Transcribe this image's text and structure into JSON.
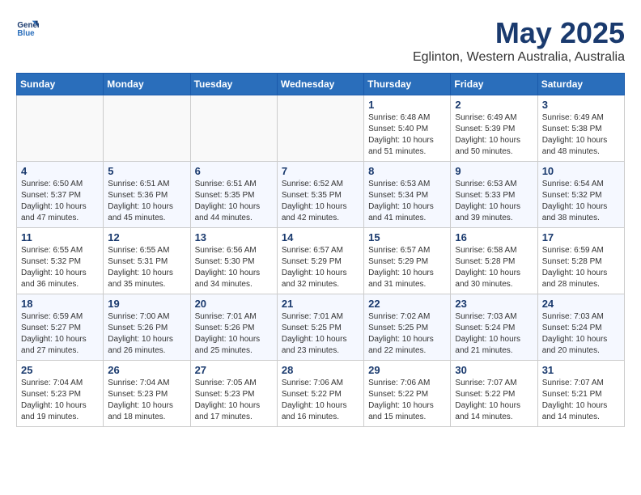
{
  "header": {
    "logo_line1": "General",
    "logo_line2": "Blue",
    "month": "May 2025",
    "location": "Eglinton, Western Australia, Australia"
  },
  "weekdays": [
    "Sunday",
    "Monday",
    "Tuesday",
    "Wednesday",
    "Thursday",
    "Friday",
    "Saturday"
  ],
  "weeks": [
    [
      {
        "day": "",
        "sunrise": "",
        "sunset": "",
        "daylight": ""
      },
      {
        "day": "",
        "sunrise": "",
        "sunset": "",
        "daylight": ""
      },
      {
        "day": "",
        "sunrise": "",
        "sunset": "",
        "daylight": ""
      },
      {
        "day": "",
        "sunrise": "",
        "sunset": "",
        "daylight": ""
      },
      {
        "day": "1",
        "sunrise": "Sunrise: 6:48 AM",
        "sunset": "Sunset: 5:40 PM",
        "daylight": "Daylight: 10 hours and 51 minutes."
      },
      {
        "day": "2",
        "sunrise": "Sunrise: 6:49 AM",
        "sunset": "Sunset: 5:39 PM",
        "daylight": "Daylight: 10 hours and 50 minutes."
      },
      {
        "day": "3",
        "sunrise": "Sunrise: 6:49 AM",
        "sunset": "Sunset: 5:38 PM",
        "daylight": "Daylight: 10 hours and 48 minutes."
      }
    ],
    [
      {
        "day": "4",
        "sunrise": "Sunrise: 6:50 AM",
        "sunset": "Sunset: 5:37 PM",
        "daylight": "Daylight: 10 hours and 47 minutes."
      },
      {
        "day": "5",
        "sunrise": "Sunrise: 6:51 AM",
        "sunset": "Sunset: 5:36 PM",
        "daylight": "Daylight: 10 hours and 45 minutes."
      },
      {
        "day": "6",
        "sunrise": "Sunrise: 6:51 AM",
        "sunset": "Sunset: 5:35 PM",
        "daylight": "Daylight: 10 hours and 44 minutes."
      },
      {
        "day": "7",
        "sunrise": "Sunrise: 6:52 AM",
        "sunset": "Sunset: 5:35 PM",
        "daylight": "Daylight: 10 hours and 42 minutes."
      },
      {
        "day": "8",
        "sunrise": "Sunrise: 6:53 AM",
        "sunset": "Sunset: 5:34 PM",
        "daylight": "Daylight: 10 hours and 41 minutes."
      },
      {
        "day": "9",
        "sunrise": "Sunrise: 6:53 AM",
        "sunset": "Sunset: 5:33 PM",
        "daylight": "Daylight: 10 hours and 39 minutes."
      },
      {
        "day": "10",
        "sunrise": "Sunrise: 6:54 AM",
        "sunset": "Sunset: 5:32 PM",
        "daylight": "Daylight: 10 hours and 38 minutes."
      }
    ],
    [
      {
        "day": "11",
        "sunrise": "Sunrise: 6:55 AM",
        "sunset": "Sunset: 5:32 PM",
        "daylight": "Daylight: 10 hours and 36 minutes."
      },
      {
        "day": "12",
        "sunrise": "Sunrise: 6:55 AM",
        "sunset": "Sunset: 5:31 PM",
        "daylight": "Daylight: 10 hours and 35 minutes."
      },
      {
        "day": "13",
        "sunrise": "Sunrise: 6:56 AM",
        "sunset": "Sunset: 5:30 PM",
        "daylight": "Daylight: 10 hours and 34 minutes."
      },
      {
        "day": "14",
        "sunrise": "Sunrise: 6:57 AM",
        "sunset": "Sunset: 5:29 PM",
        "daylight": "Daylight: 10 hours and 32 minutes."
      },
      {
        "day": "15",
        "sunrise": "Sunrise: 6:57 AM",
        "sunset": "Sunset: 5:29 PM",
        "daylight": "Daylight: 10 hours and 31 minutes."
      },
      {
        "day": "16",
        "sunrise": "Sunrise: 6:58 AM",
        "sunset": "Sunset: 5:28 PM",
        "daylight": "Daylight: 10 hours and 30 minutes."
      },
      {
        "day": "17",
        "sunrise": "Sunrise: 6:59 AM",
        "sunset": "Sunset: 5:28 PM",
        "daylight": "Daylight: 10 hours and 28 minutes."
      }
    ],
    [
      {
        "day": "18",
        "sunrise": "Sunrise: 6:59 AM",
        "sunset": "Sunset: 5:27 PM",
        "daylight": "Daylight: 10 hours and 27 minutes."
      },
      {
        "day": "19",
        "sunrise": "Sunrise: 7:00 AM",
        "sunset": "Sunset: 5:26 PM",
        "daylight": "Daylight: 10 hours and 26 minutes."
      },
      {
        "day": "20",
        "sunrise": "Sunrise: 7:01 AM",
        "sunset": "Sunset: 5:26 PM",
        "daylight": "Daylight: 10 hours and 25 minutes."
      },
      {
        "day": "21",
        "sunrise": "Sunrise: 7:01 AM",
        "sunset": "Sunset: 5:25 PM",
        "daylight": "Daylight: 10 hours and 23 minutes."
      },
      {
        "day": "22",
        "sunrise": "Sunrise: 7:02 AM",
        "sunset": "Sunset: 5:25 PM",
        "daylight": "Daylight: 10 hours and 22 minutes."
      },
      {
        "day": "23",
        "sunrise": "Sunrise: 7:03 AM",
        "sunset": "Sunset: 5:24 PM",
        "daylight": "Daylight: 10 hours and 21 minutes."
      },
      {
        "day": "24",
        "sunrise": "Sunrise: 7:03 AM",
        "sunset": "Sunset: 5:24 PM",
        "daylight": "Daylight: 10 hours and 20 minutes."
      }
    ],
    [
      {
        "day": "25",
        "sunrise": "Sunrise: 7:04 AM",
        "sunset": "Sunset: 5:23 PM",
        "daylight": "Daylight: 10 hours and 19 minutes."
      },
      {
        "day": "26",
        "sunrise": "Sunrise: 7:04 AM",
        "sunset": "Sunset: 5:23 PM",
        "daylight": "Daylight: 10 hours and 18 minutes."
      },
      {
        "day": "27",
        "sunrise": "Sunrise: 7:05 AM",
        "sunset": "Sunset: 5:23 PM",
        "daylight": "Daylight: 10 hours and 17 minutes."
      },
      {
        "day": "28",
        "sunrise": "Sunrise: 7:06 AM",
        "sunset": "Sunset: 5:22 PM",
        "daylight": "Daylight: 10 hours and 16 minutes."
      },
      {
        "day": "29",
        "sunrise": "Sunrise: 7:06 AM",
        "sunset": "Sunset: 5:22 PM",
        "daylight": "Daylight: 10 hours and 15 minutes."
      },
      {
        "day": "30",
        "sunrise": "Sunrise: 7:07 AM",
        "sunset": "Sunset: 5:22 PM",
        "daylight": "Daylight: 10 hours and 14 minutes."
      },
      {
        "day": "31",
        "sunrise": "Sunrise: 7:07 AM",
        "sunset": "Sunset: 5:21 PM",
        "daylight": "Daylight: 10 hours and 14 minutes."
      }
    ]
  ]
}
